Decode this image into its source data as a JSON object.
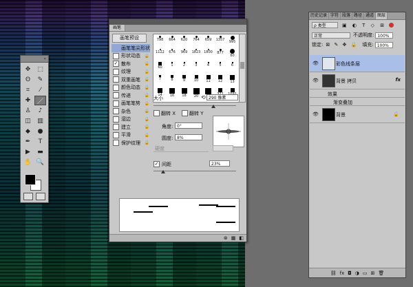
{
  "toolbox": {
    "tools": [
      {
        "name": "move-icon",
        "glyph": "✥"
      },
      {
        "name": "marquee-icon",
        "glyph": "⬚"
      },
      {
        "name": "lasso-icon",
        "glyph": "ʘ"
      },
      {
        "name": "quick-select-icon",
        "glyph": "✎"
      },
      {
        "name": "crop-icon",
        "glyph": "⌗"
      },
      {
        "name": "eyedropper-icon",
        "glyph": "⁄"
      },
      {
        "name": "healing-icon",
        "glyph": "✚"
      },
      {
        "name": "brush-icon",
        "glyph": "／"
      },
      {
        "name": "stamp-icon",
        "glyph": "♙"
      },
      {
        "name": "history-brush-icon",
        "glyph": "♪"
      },
      {
        "name": "eraser-icon",
        "glyph": "◫"
      },
      {
        "name": "gradient-icon",
        "glyph": "▥"
      },
      {
        "name": "blur-icon",
        "glyph": "◆"
      },
      {
        "name": "dodge-icon",
        "glyph": "●"
      },
      {
        "name": "pen-icon",
        "glyph": "✒"
      },
      {
        "name": "type-icon",
        "glyph": "T"
      },
      {
        "name": "path-select-icon",
        "glyph": "▶"
      },
      {
        "name": "shape-icon",
        "glyph": "▬"
      },
      {
        "name": "hand-icon",
        "glyph": "✋"
      },
      {
        "name": "zoom-icon",
        "glyph": "🔍"
      }
    ],
    "selected_tool": "brush-icon"
  },
  "brush_panel": {
    "tab_label": "画笔",
    "presets_button": "画笔预设",
    "options": [
      {
        "label": "画笔笔尖形状",
        "checked": false,
        "selected": true,
        "lock": false
      },
      {
        "label": "形状动态",
        "checked": false,
        "selected": false,
        "lock": true
      },
      {
        "label": "散布",
        "checked": true,
        "selected": false,
        "lock": true
      },
      {
        "label": "纹理",
        "checked": false,
        "selected": false,
        "lock": true
      },
      {
        "label": "双重画笔",
        "checked": false,
        "selected": false,
        "lock": true
      },
      {
        "label": "颜色动态",
        "checked": false,
        "selected": false,
        "lock": true
      },
      {
        "label": "传递",
        "checked": false,
        "selected": false,
        "lock": true
      },
      {
        "label": "画笔笔势",
        "checked": false,
        "selected": false,
        "lock": true
      },
      {
        "label": "杂色",
        "checked": false,
        "selected": false,
        "lock": true
      },
      {
        "label": "湿边",
        "checked": false,
        "selected": false,
        "lock": true
      },
      {
        "label": "建立",
        "checked": false,
        "selected": false,
        "lock": true
      },
      {
        "label": "平滑",
        "checked": false,
        "selected": false,
        "lock": true
      },
      {
        "label": "保护纹理",
        "checked": false,
        "selected": false,
        "lock": true
      }
    ],
    "tips": [
      {
        "num": "798",
        "dot": 3
      },
      {
        "num": "664",
        "dot": 3
      },
      {
        "num": "620",
        "dot": 3
      },
      {
        "num": "764",
        "dot": 3
      },
      {
        "num": "659",
        "dot": 3
      },
      {
        "num": "1357",
        "dot": 3
      },
      {
        "num": "995",
        "dot": 6
      },
      {
        "num": "1122",
        "dot": 2
      },
      {
        "num": "676",
        "dot": 2
      },
      {
        "num": "969",
        "dot": 2
      },
      {
        "num": "1823",
        "dot": 2
      },
      {
        "num": "1800",
        "dot": 2
      },
      {
        "num": "877",
        "dot": 3
      },
      {
        "num": "60",
        "dot": 7
      },
      {
        "num": "60",
        "dot": 5
      },
      {
        "num": "1",
        "dot": 2
      },
      {
        "num": "2",
        "dot": 2
      },
      {
        "num": "3",
        "dot": 2
      },
      {
        "num": "4",
        "dot": 2
      },
      {
        "num": "5",
        "dot": 2
      },
      {
        "num": "6",
        "dot": 2
      },
      {
        "num": "7",
        "dot": 3
      },
      {
        "num": "8",
        "dot": 4
      },
      {
        "num": "9",
        "dot": 5
      },
      {
        "num": "10",
        "dot": 5
      },
      {
        "num": "11",
        "dot": 6
      },
      {
        "num": "12",
        "dot": 6
      },
      {
        "num": "13",
        "dot": 7
      },
      {
        "num": "14",
        "dot": 7
      },
      {
        "num": "16",
        "dot": 8
      },
      {
        "num": "18",
        "dot": 8
      },
      {
        "num": "20",
        "dot": 9
      },
      {
        "num": "22",
        "dot": 9
      },
      {
        "num": "371",
        "dot": 6
      },
      {
        "num": "1091",
        "dot": 6
      }
    ],
    "size_label": "大小",
    "size_value": "290 像素",
    "flip_x": "翻转 X",
    "flip_y": "翻转 Y",
    "angle_label": "角度:",
    "angle_value": "0°",
    "roundness_label": "圆度:",
    "roundness_value": "8%",
    "hardness_label": "硬度",
    "spacing_label": "间距",
    "spacing_value": "23%",
    "spacing_checked": true,
    "foot_icons": [
      "toggle-icon",
      "grid-icon",
      "new-icon"
    ]
  },
  "layers_panel": {
    "tabs": [
      "历史记录",
      "字符",
      "段落",
      "路径",
      "通道",
      "图层"
    ],
    "active_tab": "图层",
    "filter_label": "ρ 类型",
    "blend_mode": "正常",
    "opacity_label": "不透明度:",
    "opacity_value": "100%",
    "lock_label": "锁定:",
    "fill_label": "填充:",
    "fill_value": "100%",
    "layers": [
      {
        "name": "彩色线条层",
        "selected": true,
        "thumb": "#dfe6ee"
      },
      {
        "name": "背景 拷贝",
        "selected": false,
        "thumb": "#333",
        "fx": "fx"
      },
      {
        "name": "效果",
        "selected": false,
        "sub": true
      },
      {
        "name": "渐变叠加",
        "selected": false,
        "sub": true
      },
      {
        "name": "背景",
        "selected": false,
        "thumb": "#000"
      }
    ],
    "foot_icons": [
      "link-icon",
      "fx-icon",
      "mask-icon",
      "adjust-icon",
      "folder-icon",
      "new-layer-icon",
      "trash-icon"
    ]
  }
}
